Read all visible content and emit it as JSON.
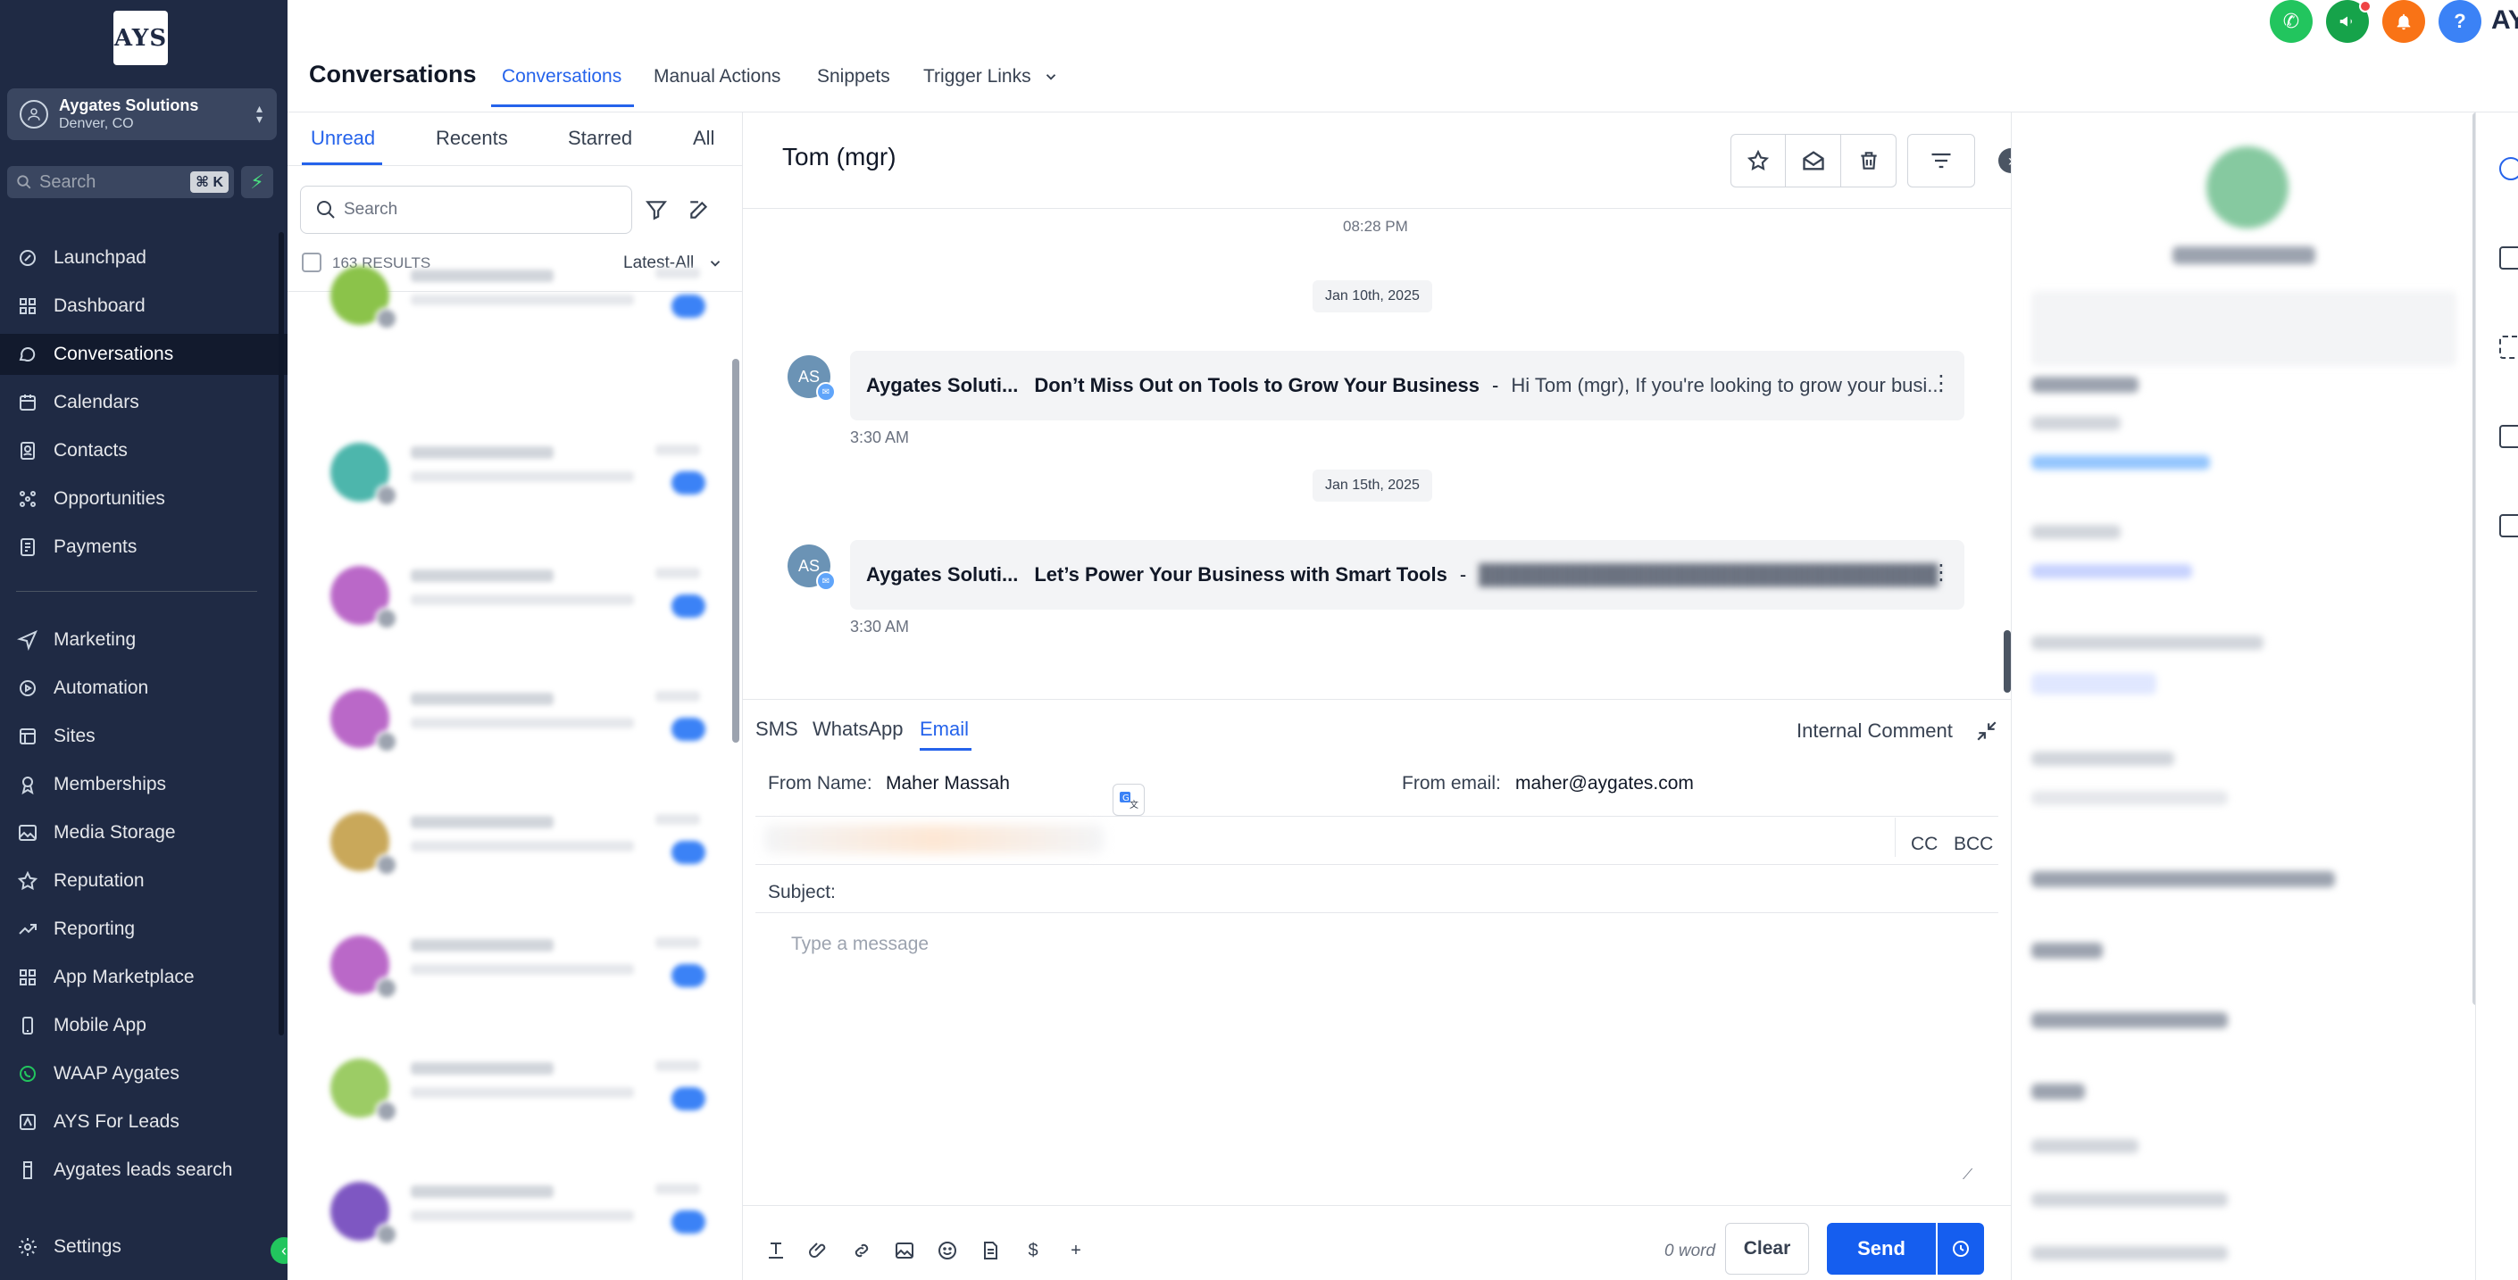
{
  "colors": {
    "sidebar_bg": "#1f2a44",
    "accent": "#2563eb",
    "send": "#155eef",
    "success": "#22c55e"
  },
  "sidebar": {
    "logo_text": "AYS",
    "account": {
      "name": "Aygates Solutions",
      "location": "Denver, CO"
    },
    "search": {
      "placeholder": "Search",
      "shortcut": "⌘ K"
    },
    "items": [
      {
        "label": "Launchpad",
        "icon": "rocket-icon"
      },
      {
        "label": "Dashboard",
        "icon": "grid-icon"
      },
      {
        "label": "Conversations",
        "icon": "chat-icon",
        "active": true
      },
      {
        "label": "Calendars",
        "icon": "calendar-icon"
      },
      {
        "label": "Contacts",
        "icon": "contacts-icon"
      },
      {
        "label": "Opportunities",
        "icon": "opportunities-icon"
      },
      {
        "label": "Payments",
        "icon": "payments-icon"
      },
      {
        "label": "Marketing",
        "icon": "send-icon"
      },
      {
        "label": "Automation",
        "icon": "automation-icon"
      },
      {
        "label": "Sites",
        "icon": "sites-icon"
      },
      {
        "label": "Memberships",
        "icon": "award-icon"
      },
      {
        "label": "Media Storage",
        "icon": "image-icon"
      },
      {
        "label": "Reputation",
        "icon": "star-icon"
      },
      {
        "label": "Reporting",
        "icon": "trend-icon"
      },
      {
        "label": "App Marketplace",
        "icon": "apps-icon"
      },
      {
        "label": "Mobile App",
        "icon": "mobile-icon"
      },
      {
        "label": "WAAP Aygates",
        "icon": "whatsapp-icon"
      },
      {
        "label": "AYS For Leads",
        "icon": "leads-icon"
      },
      {
        "label": "Aygates leads search",
        "icon": "leads-search-icon"
      },
      {
        "label": "Settings",
        "icon": "gear-icon"
      }
    ]
  },
  "header": {
    "title": "Conversations",
    "tabs": [
      "Conversations",
      "Manual Actions",
      "Snippets",
      "Trigger Links"
    ],
    "brand_mark": "AY"
  },
  "list": {
    "tabs": [
      "Unread",
      "Recents",
      "Starred",
      "All"
    ],
    "search_placeholder": "Search",
    "results": "163 RESULTS",
    "sort": "Latest-All"
  },
  "chat": {
    "contact_name": "Tom (mgr)",
    "top_time": "08:28 PM",
    "messages": [
      {
        "date": "Jan 10th, 2025",
        "avatar": "AS",
        "sender": "Aygates Soluti...",
        "subject": "Don’t Miss Out on Tools to Grow Your Business",
        "separator": "-",
        "snippet": "Hi Tom (mgr), If you're looking to grow your busi...",
        "time": "3:30 AM"
      },
      {
        "date": "Jan 15th, 2025",
        "avatar": "AS",
        "sender": "Aygates Soluti...",
        "subject": "Let’s Power Your Business with Smart Tools",
        "separator": "-",
        "snippet": "",
        "time": "3:30 AM"
      }
    ]
  },
  "composer": {
    "tabs": [
      "SMS",
      "WhatsApp",
      "Email"
    ],
    "internal_comment": "Internal Comment",
    "from_name_label": "From Name:",
    "from_name": "Maher Massah",
    "from_email_label": "From email:",
    "from_email": "maher@aygates.com",
    "cc": "CC",
    "bcc": "BCC",
    "subject_label": "Subject:",
    "message_placeholder": "Type a message",
    "word_count": "0 word",
    "clear": "Clear",
    "send": "Send"
  }
}
